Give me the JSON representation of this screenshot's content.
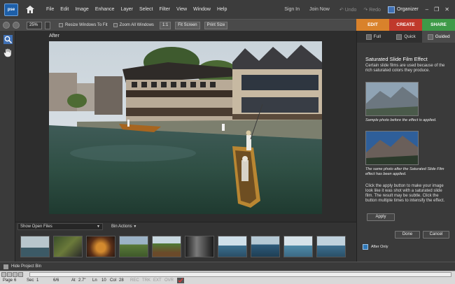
{
  "app": {
    "logo_text": "pse",
    "menu": [
      "File",
      "Edit",
      "Image",
      "Enhance",
      "Layer",
      "Select",
      "Filter",
      "View",
      "Window",
      "Help"
    ],
    "sign_in": "Sign In",
    "join_now": "Join Now",
    "undo": "Undo",
    "redo": "Redo",
    "organizer": "Organizer"
  },
  "options_bar": {
    "zoom": "25%",
    "resize_windows": "Resize Windows To Fit",
    "zoom_all": "Zoom All Windows",
    "one_to_one": "1:1",
    "fit_screen": "Fit Screen",
    "print_size": "Print Size"
  },
  "mode_tabs": [
    {
      "label": "EDIT",
      "color": "#d9822b"
    },
    {
      "label": "CREATE",
      "color": "#c0392b"
    },
    {
      "label": "SHARE",
      "color": "#3e9a48"
    }
  ],
  "canvas": {
    "title": "After"
  },
  "bin": {
    "show_open_files": "Show Open Files",
    "bin_actions": "Bin Actions",
    "hide_project_bin": "Hide Project Bin"
  },
  "panel": {
    "tabs": [
      "Full",
      "Quick",
      "Guided"
    ],
    "active_tab": "Guided",
    "title": "Saturated Slide Film Effect",
    "description": "Certain slide films are used because of the rich saturated colors they produce.",
    "caption_before": "Sample photo before the effect is applied.",
    "caption_after": "The same photo after the Saturated Slide Film effect has been applied.",
    "instructions": "Click the apply button to make your image look like it was shot with a saturated slide film. The result may be subtle. Click the button multiple times to intensify the effect.",
    "apply": "Apply",
    "done": "Done",
    "cancel": "Cancel",
    "after_only": "After Only"
  },
  "status": {
    "page": "Page",
    "page_no": "6",
    "sec": "Sec",
    "sec_no": "1",
    "page_of": "6/6",
    "at": "At",
    "at_val": "2.7\"",
    "ln": "Ln",
    "ln_val": "10",
    "col": "Col",
    "col_val": "28",
    "rec": "REC",
    "trk": "TRK",
    "ext": "EXT",
    "ovr": "OVR"
  }
}
